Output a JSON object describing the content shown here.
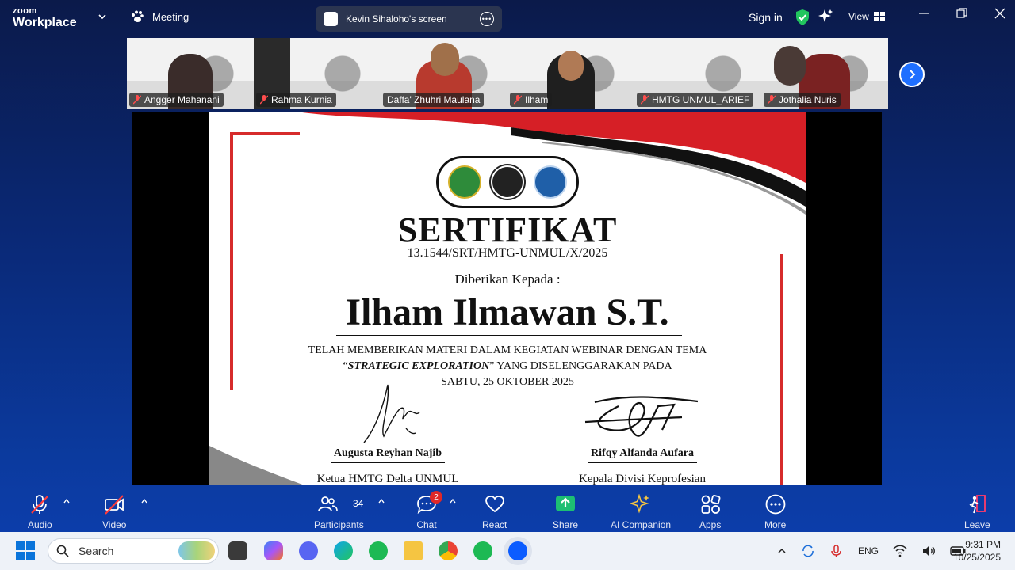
{
  "app": {
    "brand_top": "zoom",
    "brand_bottom": "Workplace",
    "meeting_label": "Meeting"
  },
  "share_banner": {
    "label": "Kevin Sihaloho's screen"
  },
  "header": {
    "signin": "Sign in",
    "view": "View"
  },
  "participants": [
    {
      "name": "Angger Mahanani",
      "muted": true
    },
    {
      "name": "Rahma Kurnia",
      "muted": true
    },
    {
      "name": "Daffa' Zhuhri Maulana",
      "muted": false,
      "active": true
    },
    {
      "name": "Ilham",
      "muted": true
    },
    {
      "name": "HMTG UNMUL_ARIEF",
      "muted": true
    },
    {
      "name": "Jothalia Nuris",
      "muted": true
    }
  ],
  "certificate": {
    "title": "SERTIFIKAT",
    "number": "13.1544/SRT/HMTG-UNMUL/X/2025",
    "given_to": "Diberikan Kepada :",
    "recipient": "Ilham Ilmawan S.T.",
    "line1": "TELAH MEMBERIKAN MATERI DALAM KEGIATAN WEBINAR DENGAN TEMA",
    "theme_open": "“",
    "theme": "STRATEGIC EXPLORATION",
    "theme_close": "” YANG DISELENGGARAKAN PADA",
    "date": "SABTU, 25 OKTOBER 2025",
    "signer1_name": "Augusta Reyhan Najib",
    "signer1_role": "Ketua HMTG Delta UNMUL",
    "signer2_name": "Rifqy Alfanda Aufara",
    "signer2_role": "Kepala Divisi Keprofesian"
  },
  "toolbar": {
    "audio": "Audio",
    "video": "Video",
    "participants": "Participants",
    "participants_count": "34",
    "chat": "Chat",
    "chat_badge": "2",
    "react": "React",
    "share": "Share",
    "ai": "AI Companion",
    "apps": "Apps",
    "more": "More",
    "leave": "Leave"
  },
  "taskbar": {
    "search_placeholder": "Search",
    "lang": "ENG",
    "time": "9:31 PM",
    "date": "10/25/2025"
  },
  "colors": {
    "accent": "#2bd98a",
    "danger": "#e02828",
    "share_green": "#1dbf73",
    "zoom_blue": "#0b5cff"
  }
}
